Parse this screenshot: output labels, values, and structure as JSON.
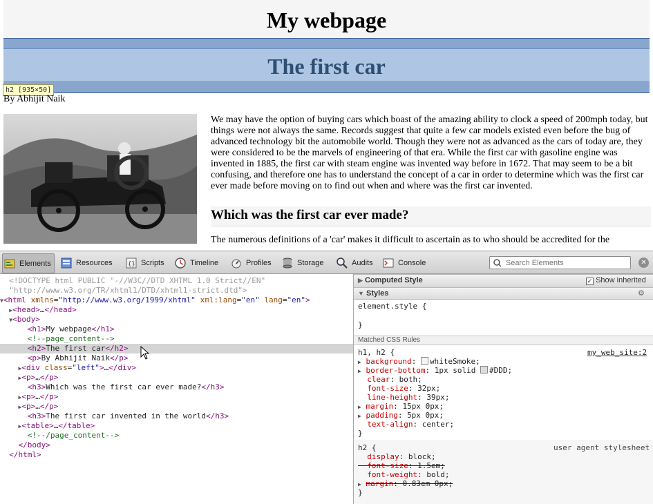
{
  "page": {
    "h1": "My webpage",
    "h2": "The first car",
    "h2_tooltip": "h2 [935×50]",
    "author": "By Abhijit Naik",
    "intro": "We may have the option of buying cars which boast of the amazing ability to clock a speed of 200mph today, but things were not always the same. Records suggest that quite a few car models existed even before the bug of advanced technology bit the automobile world. Though they were not as advanced as the cars of today are, they were considered to be the marvels of engineering of that era. While the first car with gasoline engine was invented in 1885, the first car with steam engine was invented way before in 1672. That may seem to be a bit confusing, and therefore one has to understand the concept of a car in order to determine which was the first car ever made before moving on to find out when and where was the first car invented.",
    "h3": "Which was the first car ever made?",
    "para2": "The numerous definitions of a 'car' makes it difficult to ascertain as to who should be accredited for the"
  },
  "toolbar": {
    "tabs": [
      {
        "label": "Elements",
        "icon": "elements-icon"
      },
      {
        "label": "Resources",
        "icon": "resources-icon"
      },
      {
        "label": "Scripts",
        "icon": "scripts-icon"
      },
      {
        "label": "Timeline",
        "icon": "timeline-icon"
      },
      {
        "label": "Profiles",
        "icon": "profiles-icon"
      },
      {
        "label": "Storage",
        "icon": "storage-icon"
      },
      {
        "label": "Audits",
        "icon": "audits-icon"
      },
      {
        "label": "Console",
        "icon": "console-icon"
      }
    ],
    "active_tab": "Elements",
    "search_placeholder": "Search Elements"
  },
  "dom": {
    "doctype1": "<!DOCTYPE html PUBLIC \"-//W3C//DTD XHTML 1.0 Strict//EN\"",
    "doctype2": "\"http://www.w3.org/TR/xhtml1/DTD/xhtml1-strict.dtd\">",
    "html_xmlns": "http://www.w3.org/1999/xhtml",
    "html_xml_lang": "en",
    "html_lang": "en",
    "h1_text": "My webpage",
    "comment_open": "page_content",
    "h2_text": "The first car",
    "p_text": "By Abhijit Naik",
    "div_class": "left",
    "h3a_text": "Which was the first car ever made?",
    "h3b_text": "The first car invented in the world",
    "comment_close": "/page_content"
  },
  "styles": {
    "computed_title": "Computed Style",
    "show_inherited": "Show inherited",
    "styles_title": "Styles",
    "element_style": "element.style {",
    "close_brace": "}",
    "matched_rules": "Matched CSS Rules",
    "rule1_selector": "h1, h2 {",
    "rule1_source": "my_web_site:2",
    "rule1_props": [
      {
        "name": "background",
        "value": "whiteSmoke",
        "swatch": "#f5f5f5",
        "expandable": true
      },
      {
        "name": "border-bottom",
        "value": "1px solid ",
        "value2": "#DDD",
        "swatch": "#dddddd",
        "expandable": true
      },
      {
        "name": "clear",
        "value": "both"
      },
      {
        "name": "font-size",
        "value": "32px"
      },
      {
        "name": "line-height",
        "value": "39px"
      },
      {
        "name": "margin",
        "value": "15px 0px",
        "expandable": true
      },
      {
        "name": "padding",
        "value": "5px 0px",
        "expandable": true
      },
      {
        "name": "text-align",
        "value": "center"
      }
    ],
    "rule2_selector": "h2 {",
    "rule2_source": "user agent stylesheet",
    "rule2_props": [
      {
        "name": "display",
        "value": "block"
      },
      {
        "name": "font-size",
        "value": "1.5em",
        "struck": true
      },
      {
        "name": "font-weight",
        "value": "bold"
      },
      {
        "name": "margin",
        "value": "0.83em 0px",
        "struck": true,
        "expandable": true
      }
    ]
  }
}
